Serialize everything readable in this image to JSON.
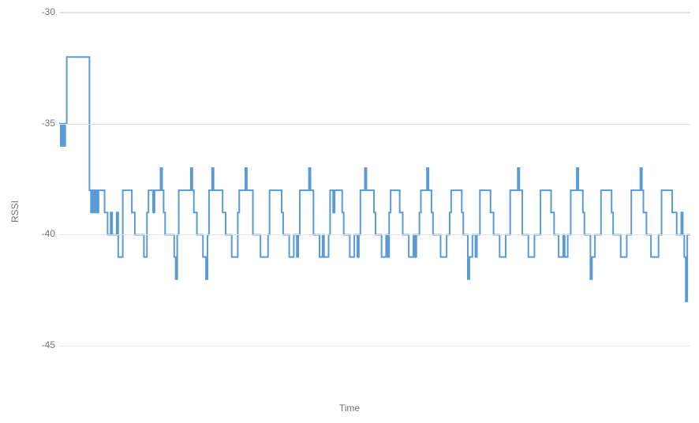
{
  "chart_data": {
    "type": "line",
    "style": "step",
    "title": "",
    "xlabel": "Time",
    "ylabel": "RSSI",
    "ylim": [
      -46.7,
      -30
    ],
    "yticks": [
      -30,
      -35,
      -40,
      -45
    ],
    "series": [
      {
        "name": "RSSI",
        "color": "#5b9bd5",
        "values": [
          -35,
          -36,
          -35,
          -36,
          -35,
          -32,
          -32,
          -32,
          -32,
          -32,
          -32,
          -32,
          -32,
          -32,
          -32,
          -32,
          -32,
          -32,
          -32,
          -32,
          -38,
          -39,
          -38,
          -39,
          -38,
          -39,
          -38,
          -38,
          -38,
          -38,
          -39,
          -39,
          -40,
          -40,
          -39,
          -40,
          -40,
          -40,
          -39,
          -41,
          -41,
          -41,
          -38,
          -38,
          -38,
          -38,
          -38,
          -38,
          -39,
          -39,
          -40,
          -40,
          -40,
          -40,
          -40,
          -40,
          -41,
          -41,
          -39,
          -38,
          -38,
          -38,
          -39,
          -38,
          -38,
          -38,
          -38,
          -37,
          -38,
          -39,
          -40,
          -40,
          -40,
          -40,
          -40,
          -40,
          -41,
          -42,
          -40,
          -38,
          -38,
          -38,
          -38,
          -38,
          -38,
          -38,
          -38,
          -37,
          -38,
          -39,
          -39,
          -40,
          -40,
          -40,
          -40,
          -41,
          -41,
          -42,
          -40,
          -38,
          -38,
          -37,
          -38,
          -38,
          -38,
          -38,
          -38,
          -38,
          -39,
          -39,
          -40,
          -40,
          -40,
          -40,
          -41,
          -41,
          -41,
          -41,
          -39,
          -38,
          -38,
          -38,
          -38,
          -37,
          -38,
          -38,
          -38,
          -38,
          -40,
          -40,
          -40,
          -40,
          -40,
          -41,
          -41,
          -41,
          -41,
          -41,
          -40,
          -38,
          -38,
          -38,
          -38,
          -38,
          -38,
          -38,
          -38,
          -39,
          -40,
          -40,
          -40,
          -40,
          -41,
          -41,
          -41,
          -40,
          -40,
          -41,
          -40,
          -38,
          -38,
          -38,
          -38,
          -38,
          -38,
          -37,
          -38,
          -38,
          -40,
          -40,
          -40,
          -40,
          -41,
          -41,
          -40,
          -41,
          -41,
          -41,
          -40,
          -38,
          -38,
          -39,
          -38,
          -38,
          -38,
          -38,
          -38,
          -39,
          -40,
          -40,
          -40,
          -40,
          -41,
          -41,
          -41,
          -40,
          -40,
          -41,
          -40,
          -38,
          -38,
          -38,
          -37,
          -38,
          -38,
          -38,
          -38,
          -38,
          -39,
          -40,
          -40,
          -40,
          -40,
          -41,
          -41,
          -41,
          -40,
          -41,
          -39,
          -38,
          -38,
          -38,
          -38,
          -38,
          -38,
          -39,
          -39,
          -40,
          -40,
          -40,
          -40,
          -41,
          -41,
          -41,
          -40,
          -41,
          -40,
          -40,
          -39,
          -38,
          -38,
          -38,
          -38,
          -37,
          -38,
          -38,
          -39,
          -40,
          -40,
          -40,
          -40,
          -40,
          -41,
          -41,
          -41,
          -41,
          -40,
          -40,
          -39,
          -38,
          -38,
          -38,
          -38,
          -38,
          -38,
          -38,
          -39,
          -40,
          -40,
          -40,
          -42,
          -41,
          -41,
          -40,
          -40,
          -41,
          -40,
          -40,
          -38,
          -38,
          -38,
          -38,
          -38,
          -38,
          -38,
          -39,
          -39,
          -40,
          -40,
          -40,
          -40,
          -41,
          -41,
          -41,
          -41,
          -40,
          -40,
          -40,
          -38,
          -38,
          -38,
          -38,
          -38,
          -37,
          -38,
          -38,
          -40,
          -40,
          -40,
          -40,
          -41,
          -41,
          -41,
          -41,
          -40,
          -40,
          -40,
          -40,
          -38,
          -38,
          -38,
          -38,
          -38,
          -38,
          -38,
          -39,
          -39,
          -40,
          -40,
          -40,
          -41,
          -41,
          -41,
          -40,
          -41,
          -41,
          -40,
          -40,
          -38,
          -38,
          -38,
          -38,
          -37,
          -38,
          -38,
          -38,
          -39,
          -40,
          -40,
          -40,
          -40,
          -42,
          -41,
          -41,
          -40,
          -40,
          -40,
          -40,
          -38,
          -38,
          -38,
          -38,
          -38,
          -38,
          -38,
          -39,
          -40,
          -40,
          -40,
          -40,
          -40,
          -41,
          -41,
          -41,
          -41,
          -40,
          -40,
          -40,
          -38,
          -38,
          -38,
          -38,
          -38,
          -38,
          -37,
          -38,
          -39,
          -39,
          -40,
          -40,
          -40,
          -41,
          -41,
          -41,
          -41,
          -41,
          -40,
          -40,
          -38,
          -38,
          -38,
          -38,
          -38,
          -38,
          -38,
          -39,
          -39,
          -39,
          -40,
          -40,
          -40,
          -39,
          -40,
          -41,
          -43,
          -40,
          -40,
          -40
        ]
      }
    ]
  }
}
